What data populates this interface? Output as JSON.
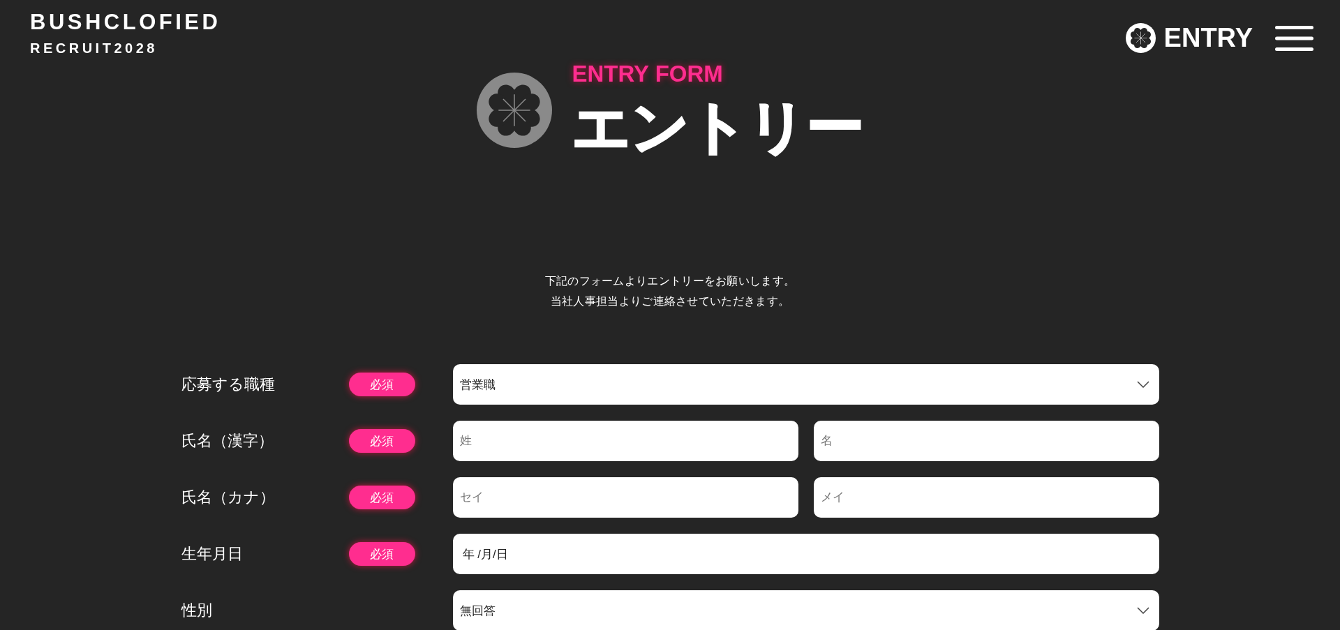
{
  "header": {
    "logo": "BUSHCLOFIED",
    "logo_subtitle": "RECRUIT2028",
    "entry_link": "ENTRY"
  },
  "hero": {
    "eyebrow": "ENTRY FORM",
    "title": "エントリー"
  },
  "intro": [
    "下記のフォームよりエントリーをお願いします。",
    "当社人事担当よりご連絡させていただきます。"
  ],
  "form": {
    "rows": [
      {
        "label": "応募する職種",
        "required": true,
        "badge": "必須",
        "inputs": [
          {
            "kind": "select",
            "value": "営業職"
          }
        ]
      },
      {
        "label": "氏名（漢字）",
        "required": true,
        "badge": "必須",
        "inputs": [
          {
            "kind": "text",
            "placeholder": "姓"
          },
          {
            "kind": "text",
            "placeholder": "名"
          }
        ]
      },
      {
        "label": "氏名（カナ）",
        "required": true,
        "badge": "必須",
        "inputs": [
          {
            "kind": "text",
            "placeholder": "セイ"
          },
          {
            "kind": "text",
            "placeholder": "メイ"
          }
        ]
      },
      {
        "label": "生年月日",
        "required": true,
        "badge": "必須",
        "inputs": [
          {
            "kind": "date",
            "value": "年 /月/日"
          }
        ]
      },
      {
        "label": "性別",
        "required": false,
        "inputs": [
          {
            "kind": "select",
            "value": "無回答"
          }
        ]
      }
    ]
  }
}
